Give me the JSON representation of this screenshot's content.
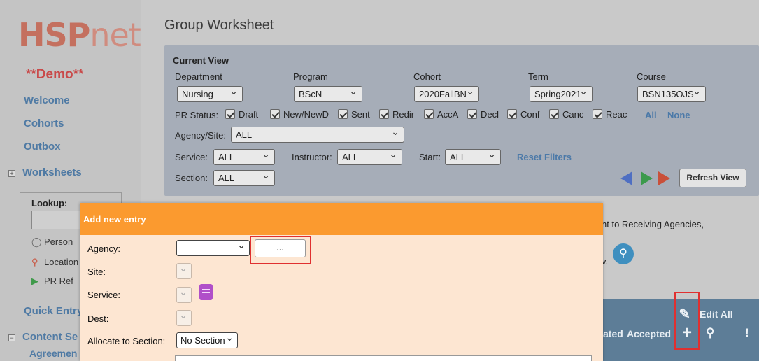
{
  "sidebar": {
    "logo": "HSPnet",
    "demo_label": "**Demo**",
    "links": {
      "welcome": "Welcome",
      "cohorts": "Cohorts",
      "outbox": "Outbox",
      "worksheets": "Worksheets",
      "quick_entry": "Quick Entry",
      "content_services": "Content Se",
      "agreements": "Agreemen"
    },
    "lookup": {
      "label": "Lookup:",
      "person": "Person",
      "location": "Location",
      "pr_ref": "PR Ref"
    }
  },
  "main": {
    "title": "Group Worksheet",
    "current_view": {
      "title": "Current View",
      "department": {
        "label": "Department",
        "value": "Nursing"
      },
      "program": {
        "label": "Program",
        "value": "BScN"
      },
      "cohort": {
        "label": "Cohort",
        "value": "2020FallBN"
      },
      "term": {
        "label": "Term",
        "value": "Spring2021"
      },
      "course": {
        "label": "Course",
        "value": "BSN135OJS"
      },
      "pr_status_label": "PR Status:",
      "pr_statuses": [
        "Draft",
        "New/NewD",
        "Sent",
        "Redir",
        "AccA",
        "Decl",
        "Conf",
        "Canc",
        "Reac"
      ],
      "all_link": "All",
      "none_link": "None",
      "agency_site": {
        "label": "Agency/Site:",
        "value": "ALL"
      },
      "service": {
        "label": "Service:",
        "value": "ALL"
      },
      "instructor": {
        "label": "Instructor:",
        "value": "ALL"
      },
      "start": {
        "label": "Start:",
        "value": "ALL"
      },
      "reset_filters": "Reset Filters",
      "section": {
        "label": "Section:",
        "value": "ALL"
      },
      "refresh_view": "Refresh View"
    },
    "behind_text_1": "nt to Receiving Agencies,",
    "behind_text_2": "v.",
    "grid": {
      "edit_all": "Edit All",
      "col_ated": "ated",
      "col_accepted": "Accepted"
    }
  },
  "modal": {
    "title": "Add new entry",
    "agency_label": "Agency:",
    "agency_value": "",
    "agency_button": "...",
    "site_label": "Site:",
    "service_label": "Service:",
    "dest_label": "Dest:",
    "allocate_label": "Allocate to Section:",
    "allocate_value": "No Section"
  },
  "colors": {
    "modal_header": "#fb9a2f",
    "modal_body": "#fde6d2",
    "link_blue": "#4f7aa4",
    "highlight_red": "#e03030"
  }
}
